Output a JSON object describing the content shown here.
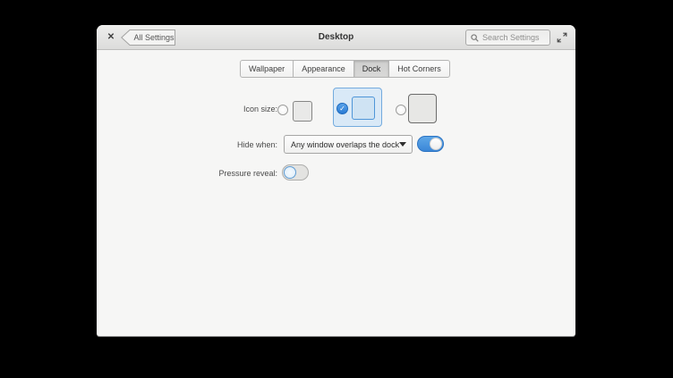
{
  "header": {
    "close_glyph": "✕",
    "back_label": "All Settings",
    "title": "Desktop",
    "search_placeholder": "Search Settings"
  },
  "tabs": {
    "items": [
      {
        "label": "Wallpaper",
        "active": false
      },
      {
        "label": "Appearance",
        "active": false
      },
      {
        "label": "Dock",
        "active": true
      },
      {
        "label": "Hot Corners",
        "active": false
      }
    ]
  },
  "dock": {
    "icon_size": {
      "label": "Icon size:",
      "check_glyph": "✓",
      "options": [
        {
          "name": "small",
          "selected": false
        },
        {
          "name": "medium",
          "selected": true
        },
        {
          "name": "large",
          "selected": false
        }
      ]
    },
    "hide_when": {
      "label": "Hide when:",
      "value": "Any window overlaps the dock",
      "switch_on": true
    },
    "pressure_reveal": {
      "label": "Pressure reveal:",
      "switch_on": false
    }
  },
  "colors": {
    "accent": "#3689e6",
    "selection_bg": "#d9e9f7",
    "selection_border": "#74abde",
    "header_bg": "#e4e4e3",
    "content_bg": "#f6f6f5"
  }
}
